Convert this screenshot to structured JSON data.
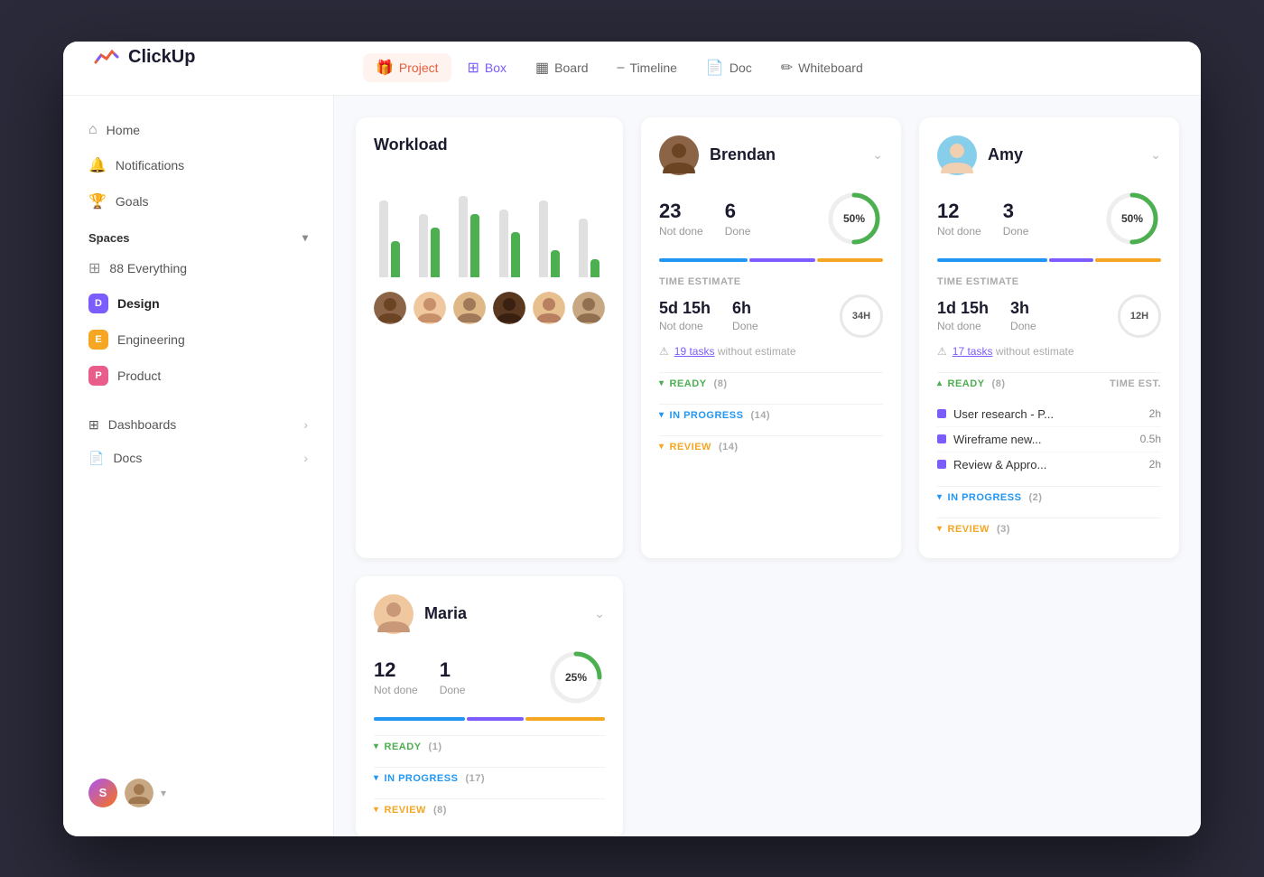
{
  "app": {
    "name": "ClickUp"
  },
  "header": {
    "tabs": [
      {
        "id": "project",
        "label": "Project",
        "icon": "🎁",
        "active": true
      },
      {
        "id": "box",
        "label": "Box",
        "icon": "⊞",
        "active": false,
        "highlight": true
      },
      {
        "id": "board",
        "label": "Board",
        "icon": "▦",
        "active": false
      },
      {
        "id": "timeline",
        "label": "Timeline",
        "icon": "═",
        "active": false
      },
      {
        "id": "doc",
        "label": "Doc",
        "icon": "📄",
        "active": false
      },
      {
        "id": "whiteboard",
        "label": "Whiteboard",
        "icon": "✏",
        "active": false
      }
    ]
  },
  "sidebar": {
    "nav_items": [
      {
        "id": "home",
        "label": "Home",
        "icon": "⌂"
      },
      {
        "id": "notifications",
        "label": "Notifications",
        "icon": "🔔"
      },
      {
        "id": "goals",
        "label": "Goals",
        "icon": "🏆"
      }
    ],
    "spaces_label": "Spaces",
    "spaces": [
      {
        "id": "everything",
        "label": "Everything",
        "count": 88,
        "type": "everything"
      },
      {
        "id": "design",
        "label": "Design",
        "badge": "D",
        "color": "#7c5cfc",
        "active": true
      },
      {
        "id": "engineering",
        "label": "Engineering",
        "badge": "E",
        "color": "#f5a623"
      },
      {
        "id": "product",
        "label": "Product",
        "badge": "P",
        "color": "#e85d8a"
      }
    ],
    "bottom_nav": [
      {
        "id": "dashboards",
        "label": "Dashboards"
      },
      {
        "id": "docs",
        "label": "Docs"
      }
    ]
  },
  "workload": {
    "title": "Workload",
    "bars": [
      {
        "gray": 85,
        "green": 40
      },
      {
        "gray": 70,
        "green": 55
      },
      {
        "gray": 90,
        "green": 70
      },
      {
        "gray": 75,
        "green": 50
      },
      {
        "gray": 85,
        "green": 30
      },
      {
        "gray": 65,
        "green": 20
      }
    ]
  },
  "brendan": {
    "name": "Brendan",
    "not_done": 23,
    "done": 6,
    "pct": 50,
    "pct_label": "50%",
    "time_estimate_label": "TIME ESTIMATE",
    "not_done_time": "5d 15h",
    "done_time": "6h",
    "badge_label": "34H",
    "warning_text": "19 tasks",
    "warning_suffix": "without estimate",
    "ready_label": "READY",
    "ready_count": "(8)",
    "inprogress_label": "IN PROGRESS",
    "inprogress_count": "(14)",
    "review_label": "REVIEW",
    "review_count": "(14)"
  },
  "amy": {
    "name": "Amy",
    "not_done": 12,
    "done": 3,
    "pct": 50,
    "pct_label": "50%",
    "time_estimate_label": "TIME ESTIMATE",
    "not_done_time": "1d 15h",
    "done_time": "3h",
    "badge_label": "12H",
    "warning_text": "17 tasks",
    "warning_suffix": "without estimate",
    "ready_label": "READY",
    "ready_count": "(8)",
    "time_est_col": "TIME EST.",
    "inprogress_label": "IN PROGRESS",
    "inprogress_count": "(2)",
    "review_label": "REVIEW",
    "review_count": "(3)",
    "tasks": [
      {
        "name": "User research - P...",
        "time": "2h"
      },
      {
        "name": "Wireframe new...",
        "time": "0.5h"
      },
      {
        "name": "Review & Appro...",
        "time": "2h"
      }
    ]
  },
  "maria": {
    "name": "Maria",
    "not_done": 12,
    "done": 1,
    "pct": 25,
    "pct_label": "25%",
    "ready_label": "READY",
    "ready_count": "(1)",
    "inprogress_label": "IN PROGRESS",
    "inprogress_count": "(17)",
    "review_label": "REVIEW",
    "review_count": "(8)"
  },
  "colors": {
    "purple": "#7c5cfc",
    "green": "#4caf50",
    "blue": "#2196f3",
    "orange": "#f5a623",
    "pink": "#e85d8a",
    "red": "#e85d3a"
  }
}
